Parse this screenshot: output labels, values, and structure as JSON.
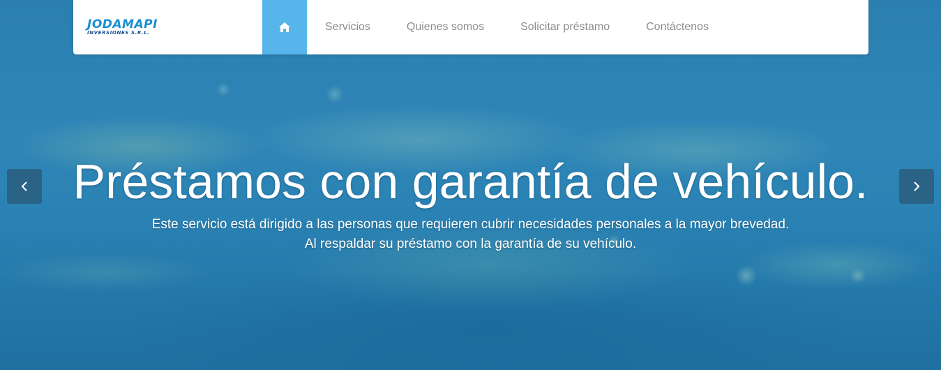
{
  "brand": {
    "name": "JODAMAPI",
    "subtitle": "INVERSIONES S.R.L."
  },
  "nav": {
    "home_icon": "home-icon",
    "items": [
      {
        "label": "Servicios"
      },
      {
        "label": "Quienes somos"
      },
      {
        "label": "Solicitar préstamo"
      },
      {
        "label": "Contáctenos"
      }
    ]
  },
  "hero": {
    "headline": "Préstamos con garantía de vehículo.",
    "line1": "Este servicio está dirigido a las personas que requieren cubrir necesidades personales a la mayor brevedad.",
    "line2": "Al respaldar su préstamo con la garantía de su vehículo."
  },
  "carousel": {
    "prev_icon": "chevron-left-icon",
    "next_icon": "chevron-right-icon"
  },
  "colors": {
    "accent": "#57b5ec",
    "nav_text": "#8d8d8d",
    "brand_blue": "#1c8fd0"
  }
}
